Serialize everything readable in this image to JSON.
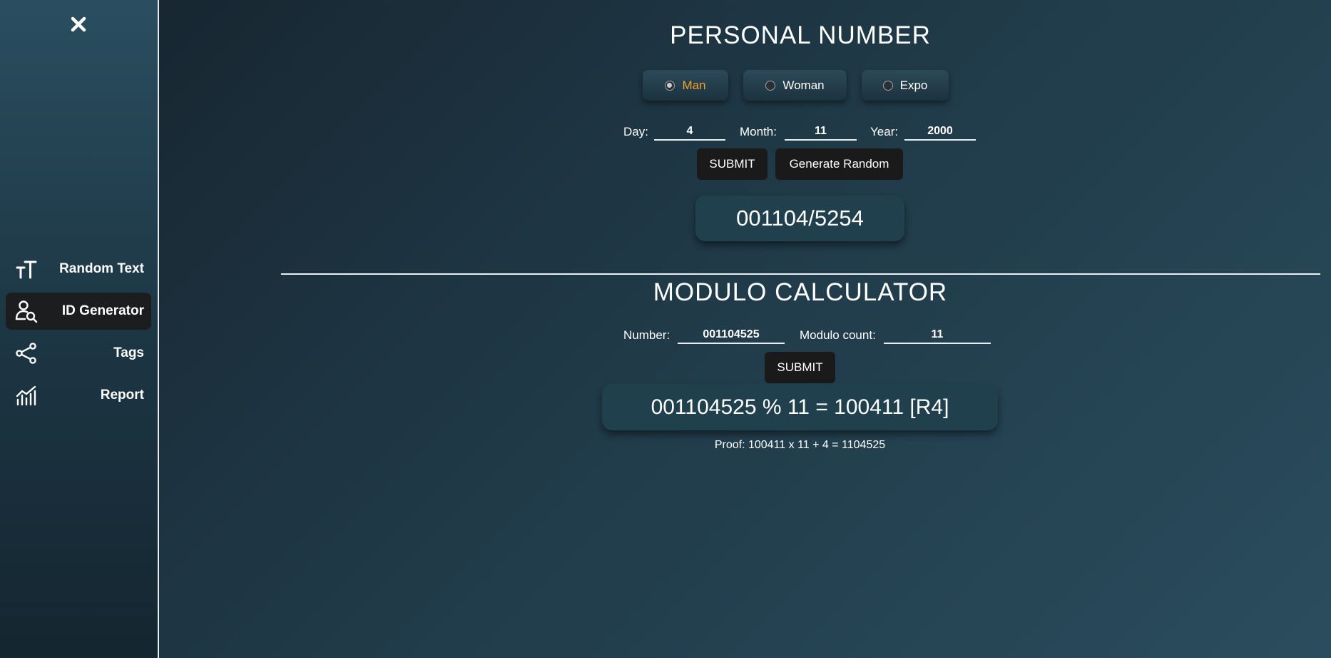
{
  "sidebar": {
    "items": [
      {
        "label": "Random Text",
        "icon": "text-size-icon"
      },
      {
        "label": "ID Generator",
        "icon": "user-search-icon"
      },
      {
        "label": "Tags",
        "icon": "share-icon"
      },
      {
        "label": "Report",
        "icon": "chart-line-icon"
      }
    ],
    "active": "ID Generator"
  },
  "personal_number": {
    "title": "PERSONAL NUMBER",
    "gender_options": [
      "Man",
      "Woman",
      "Expo"
    ],
    "selected": "Man",
    "day_label": "Day:",
    "day_value": "4",
    "month_label": "Month:",
    "month_value": "11",
    "year_label": "Year:",
    "year_value": "2000",
    "submit_label": "SUBMIT",
    "random_label": "Generate Random",
    "result": "001104/5254"
  },
  "modulo": {
    "title": "MODULO CALCULATOR",
    "number_label": "Number:",
    "number_value": "001104525",
    "count_label": "Modulo count:",
    "count_value": "11",
    "submit_label": "SUBMIT",
    "result": "001104525 % 11 = 100411 [R4]",
    "proof": "Proof: 100411 x 11 + 4 = 1104525"
  },
  "colors": {
    "selected_accent": "#f0a030",
    "active_nav_bg": "#1c1d1f"
  }
}
